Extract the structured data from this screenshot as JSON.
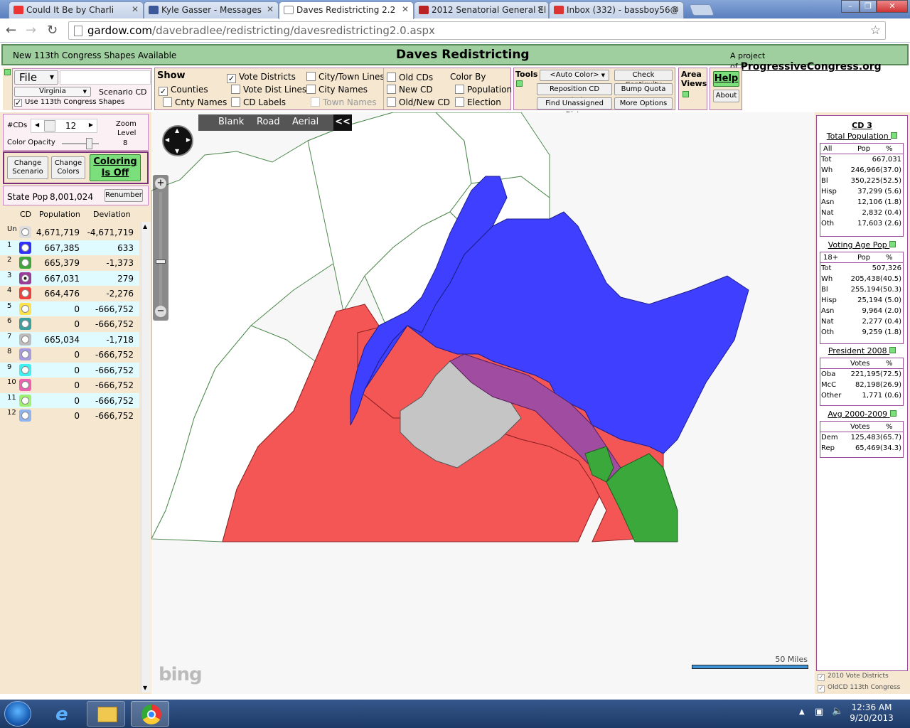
{
  "browser": {
    "tabs": [
      {
        "title": "Could It Be by Charli",
        "fav": "#e33"
      },
      {
        "title": "Kyle Gasser - Messages",
        "fav": "#3b5998"
      },
      {
        "title": "Daves Redistricting 2.2",
        "fav": "#fff"
      },
      {
        "title": "2012 Senatorial General El",
        "fav": "#b22"
      },
      {
        "title": "Inbox (332) - bassboy56@",
        "fav": "#d33"
      }
    ],
    "url_host": "gardow.com",
    "url_path": "/davebradlee/redistricting/davesredistricting2.0.aspx"
  },
  "header": {
    "notice": "New 113th Congress Shapes Available",
    "title": "Daves Redistricting",
    "project_prefix": "A project of",
    "project_link": "ProgressiveCongress.org"
  },
  "file_panel": {
    "file_label": "File",
    "state": "Virginia",
    "scenario_label": "Scenario CD",
    "use113": "Use 113th Congress Shapes"
  },
  "show_panel": {
    "heading": "Show",
    "vote_districts": "Vote Districts",
    "city_town_lines": "City/Town Lines",
    "counties": "Counties",
    "vote_dist_lines": "Vote Dist Lines",
    "city_names": "City Names",
    "cnty_names": "Cnty Names",
    "cd_labels": "CD Labels",
    "town_names": "Town Names",
    "old_cds": "Old CDs",
    "new_cd": "New CD",
    "old_new_cd": "Old/New CD",
    "color_by": "Color By",
    "population": "Population",
    "election": "Election"
  },
  "tools_panel": {
    "heading": "Tools",
    "auto_color": "<Auto Color>",
    "check_contiguity": "Check Contiguity",
    "reposition": "Reposition CD Labels",
    "bump_quota": "Bump Quota",
    "find_unassigned": "Find Unassigned Dists",
    "more_options": "More Options"
  },
  "area_panel": {
    "heading_1": "Area",
    "heading_2": "Views"
  },
  "help_panel": {
    "help": "Help",
    "about": "About"
  },
  "left": {
    "cds_label": "#CDs",
    "cds_value": "12",
    "zoom_label_1": "Zoom",
    "zoom_label_2": "Level",
    "zoom_value": "8",
    "opacity_label": "Color Opacity",
    "opacity_level": 0.75,
    "change_scenario_1": "Change",
    "change_scenario_2": "Scenario",
    "change_colors_1": "Change",
    "change_colors_2": "Colors",
    "coloring_1": "Coloring",
    "coloring_2": "Is Off",
    "state_pop_label": "State Pop",
    "state_pop": "8,001,024",
    "renumber": "Renumber",
    "col_cd": "CD",
    "col_pop": "Population",
    "col_dev": "Deviation",
    "rows": [
      {
        "cd": "Un",
        "color": "#dddddd",
        "pop": "4,671,719",
        "dev": "-4,671,719"
      },
      {
        "cd": "1",
        "color": "#3030ff",
        "pop": "667,385",
        "dev": "633"
      },
      {
        "cd": "2",
        "color": "#3aa83a",
        "pop": "665,379",
        "dev": "-1,373"
      },
      {
        "cd": "3",
        "color": "#9b3c9b",
        "pop": "667,031",
        "dev": "279"
      },
      {
        "cd": "4",
        "color": "#f04040",
        "pop": "664,476",
        "dev": "-2,276"
      },
      {
        "cd": "5",
        "color": "#ffe24a",
        "pop": "0",
        "dev": "-666,752"
      },
      {
        "cd": "6",
        "color": "#3aa0a0",
        "pop": "0",
        "dev": "-666,752"
      },
      {
        "cd": "7",
        "color": "#bdbdbd",
        "pop": "665,034",
        "dev": "-1,718"
      },
      {
        "cd": "8",
        "color": "#a89ce0",
        "pop": "0",
        "dev": "-666,752"
      },
      {
        "cd": "9",
        "color": "#40f0f0",
        "pop": "0",
        "dev": "-666,752"
      },
      {
        "cd": "10",
        "color": "#f060b0",
        "pop": "0",
        "dev": "-666,752"
      },
      {
        "cd": "11",
        "color": "#a0f070",
        "pop": "0",
        "dev": "-666,752"
      },
      {
        "cd": "12",
        "color": "#90b4f0",
        "pop": "0",
        "dev": "-666,752"
      }
    ]
  },
  "map": {
    "blank": "Blank",
    "road": "Road",
    "aerial": "Aerial",
    "collapse": "<<",
    "bing": "bing",
    "scale": "50 Miles"
  },
  "stats": {
    "title": "CD 3",
    "total_pop": {
      "heading": "Total Population",
      "h1": "All",
      "h2": "Pop",
      "h3": "%",
      "rows": [
        {
          "k": "Tot",
          "v": "667,031"
        },
        {
          "k": "Wh",
          "v": "246,966(37.0)"
        },
        {
          "k": "Bl",
          "v": "350,225(52.5)"
        },
        {
          "k": "Hisp",
          "v": "37,299 (5.6)"
        },
        {
          "k": "Asn",
          "v": "12,106 (1.8)"
        },
        {
          "k": "Nat",
          "v": "2,832 (0.4)"
        },
        {
          "k": "Oth",
          "v": "17,603 (2.6)"
        }
      ]
    },
    "vap": {
      "heading": "Voting Age Pop",
      "h1": "18+",
      "h2": "Pop",
      "h3": "%",
      "rows": [
        {
          "k": "Tot",
          "v": "507,326"
        },
        {
          "k": "Wh",
          "v": "205,438(40.5)"
        },
        {
          "k": "Bl",
          "v": "255,194(50.3)"
        },
        {
          "k": "Hisp",
          "v": "25,194 (5.0)"
        },
        {
          "k": "Asn",
          "v": "9,964 (2.0)"
        },
        {
          "k": "Nat",
          "v": "2,277 (0.4)"
        },
        {
          "k": "Oth",
          "v": "9,259 (1.8)"
        }
      ]
    },
    "pres": {
      "heading": "President 2008",
      "h2": "Votes",
      "h3": "%",
      "rows": [
        {
          "k": "Oba",
          "v": "221,195(72.5)"
        },
        {
          "k": "McC",
          "v": "82,198(26.9)"
        },
        {
          "k": "Other",
          "v": "1,771 (0.6)"
        }
      ]
    },
    "avg": {
      "heading": "Avg 2000-2009",
      "h2": "Votes",
      "h3": "%",
      "rows": [
        {
          "k": "Dem",
          "v": "125,483(65.7)"
        },
        {
          "k": "Rep",
          "v": "65,469(34.3)"
        }
      ]
    },
    "legend1": "2010 Vote Districts",
    "legend2": "OldCD 113th Congress"
  },
  "taskbar": {
    "time": "12:36 AM",
    "date": "9/20/2013"
  }
}
